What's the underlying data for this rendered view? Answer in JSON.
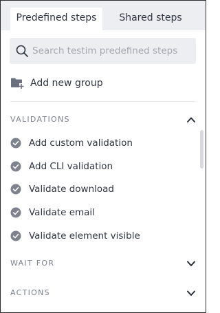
{
  "tabs": [
    {
      "label": "Predefined steps",
      "active": true
    },
    {
      "label": "Shared steps",
      "active": false
    }
  ],
  "search": {
    "placeholder": "Search testim predefined steps",
    "icon": "search-icon"
  },
  "add_group": {
    "label": "Add new group",
    "icon": "folder-plus-icon"
  },
  "sections": [
    {
      "title": "VALIDATIONS",
      "expanded": true,
      "items": [
        {
          "label": "Add custom validation",
          "icon": "check-circle-icon"
        },
        {
          "label": "Add CLI validation",
          "icon": "check-circle-icon"
        },
        {
          "label": "Validate download",
          "icon": "check-circle-icon"
        },
        {
          "label": "Validate email",
          "icon": "check-circle-icon"
        },
        {
          "label": "Validate element visible",
          "icon": "check-circle-icon"
        }
      ]
    },
    {
      "title": "WAIT FOR",
      "expanded": false
    },
    {
      "title": "ACTIONS",
      "expanded": false
    }
  ],
  "colors": {
    "tab_bar_bg": "#edeef2",
    "search_bg": "#eceef1",
    "text": "#2f3542",
    "muted_text": "#7a7f8c",
    "placeholder": "#a3a7b2",
    "check_icon": "#7d828c"
  }
}
